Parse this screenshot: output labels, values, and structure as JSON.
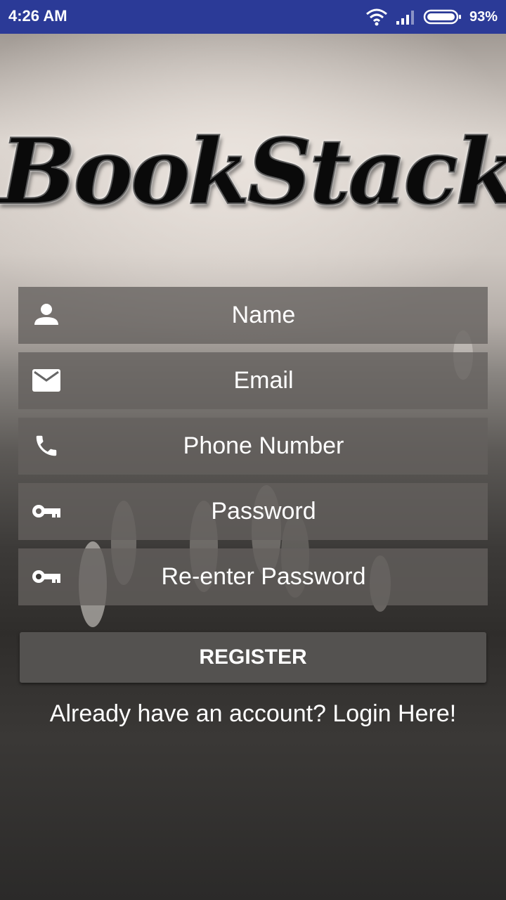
{
  "status_bar": {
    "time": "4:26 AM",
    "battery_percent": "93%",
    "icons": [
      "wifi-icon",
      "signal-icon",
      "battery-icon"
    ]
  },
  "app": {
    "logo_text": "BookStack"
  },
  "form": {
    "fields": [
      {
        "placeholder": "Name",
        "icon": "person-icon"
      },
      {
        "placeholder": "Email",
        "icon": "email-icon"
      },
      {
        "placeholder": "Phone Number",
        "icon": "phone-icon"
      },
      {
        "placeholder": "Password",
        "icon": "key-icon"
      },
      {
        "placeholder": "Re-enter Password",
        "icon": "key-icon"
      }
    ],
    "register_label": "REGISTER",
    "login_prompt": "Already have an account? Login Here!"
  },
  "colors": {
    "status_bar": "#2b3a97",
    "field_bg": "#64605d",
    "button_bg": "#545250",
    "text": "#ffffff"
  }
}
